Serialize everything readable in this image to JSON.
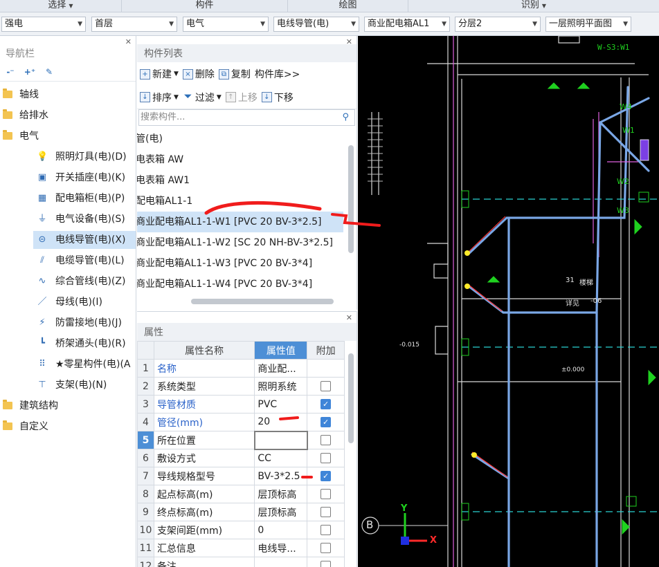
{
  "ribbon": {
    "groups": [
      "选择",
      "构件",
      "绘图",
      "识别"
    ]
  },
  "selectors": [
    {
      "value": "强电"
    },
    {
      "value": "首层"
    },
    {
      "value": "电气"
    },
    {
      "value": "电线导管(电)"
    },
    {
      "value": "商业配电箱AL1"
    },
    {
      "value": "分层2"
    },
    {
      "value": "一层照明平面图"
    }
  ],
  "nav": {
    "title": "导航栏",
    "tree": [
      {
        "label": "轴线",
        "level": 0,
        "icon": "folder-icon"
      },
      {
        "label": "给排水",
        "level": 0,
        "icon": "folder-icon"
      },
      {
        "label": "电气",
        "level": 0,
        "icon": "folder-icon"
      },
      {
        "label": "照明灯具(电)(D)",
        "level": 1,
        "icon": "light-bulb-icon"
      },
      {
        "label": "开关插座(电)(K)",
        "level": 1,
        "icon": "switch-socket-icon"
      },
      {
        "label": "配电箱柜(电)(P)",
        "level": 1,
        "icon": "distribution-box-icon"
      },
      {
        "label": "电气设备(电)(S)",
        "level": 1,
        "icon": "electrical-equipment-icon"
      },
      {
        "label": "电线导管(电)(X)",
        "level": 1,
        "icon": "wire-conduit-icon",
        "selected": true
      },
      {
        "label": "电缆导管(电)(L)",
        "level": 1,
        "icon": "cable-conduit-icon"
      },
      {
        "label": "综合管线(电)(Z)",
        "level": 1,
        "icon": "pipeline-icon"
      },
      {
        "label": "母线(电)(I)",
        "level": 1,
        "icon": "busbar-icon"
      },
      {
        "label": "防雷接地(电)(J)",
        "level": 1,
        "icon": "lightning-icon"
      },
      {
        "label": "桥架通头(电)(R)",
        "level": 1,
        "icon": "tray-fitting-icon"
      },
      {
        "label": "★零星构件(电)(A",
        "level": 1,
        "icon": "grid-icon"
      },
      {
        "label": "支架(电)(N)",
        "level": 1,
        "icon": "bracket-icon"
      },
      {
        "label": "建筑结构",
        "level": 0,
        "icon": "folder-icon"
      },
      {
        "label": "自定义",
        "level": 0,
        "icon": "folder-icon"
      }
    ]
  },
  "component_list": {
    "title": "构件列表",
    "toolbar1": {
      "new": "新建",
      "delete": "删除",
      "copy": "复制",
      "library": "构件库>>"
    },
    "toolbar2": {
      "sort": "排序",
      "filter": "过滤",
      "up": "上移",
      "down": "下移"
    },
    "search_placeholder": "搜索构件...",
    "items": [
      "管(电)",
      "电表箱 AW",
      "电表箱 AW1",
      "配电箱AL1-1",
      "商业配电箱AL1-1-W1 [PVC 20 BV-3*2.5]",
      "商业配电箱AL1-1-W2 [SC 20 NH-BV-3*2.5]",
      "商业配电箱AL1-1-W3 [PVC 20 BV-3*4]",
      "商业配电箱AL1-1-W4 [PVC 20 BV-3*4]"
    ],
    "active_index": 4
  },
  "properties": {
    "title": "属性",
    "headers": {
      "name": "属性名称",
      "value": "属性值",
      "extra": "附加"
    },
    "rows": [
      {
        "no": "1",
        "name": "名称",
        "value": "商业配...",
        "blue": true,
        "check": null
      },
      {
        "no": "2",
        "name": "系统类型",
        "value": "照明系统",
        "blue": false,
        "check": false
      },
      {
        "no": "3",
        "name": "导管材质",
        "value": "PVC",
        "blue": true,
        "check": true
      },
      {
        "no": "4",
        "name": "管径(mm)",
        "value": "20",
        "blue": true,
        "check": true
      },
      {
        "no": "5",
        "name": "所在位置",
        "value": "",
        "blue": false,
        "check": false,
        "current": true
      },
      {
        "no": "6",
        "name": "敷设方式",
        "value": "CC",
        "blue": false,
        "check": false
      },
      {
        "no": "7",
        "name": "导线规格型号",
        "value": "BV-3*2.5",
        "blue": false,
        "check": true
      },
      {
        "no": "8",
        "name": "起点标高(m)",
        "value": "层顶标高",
        "blue": false,
        "check": false
      },
      {
        "no": "9",
        "name": "终点标高(m)",
        "value": "层顶标高",
        "blue": false,
        "check": false
      },
      {
        "no": "10",
        "name": "支架间距(mm)",
        "value": "0",
        "blue": false,
        "check": false
      },
      {
        "no": "11",
        "name": "汇总信息",
        "value": "电线导...",
        "blue": false,
        "check": false
      },
      {
        "no": "12",
        "name": "备注",
        "value": "",
        "blue": false,
        "check": false
      }
    ]
  },
  "canvas": {
    "labels": {
      "top": "W-S3:W1",
      "w4": "W4",
      "w1": "W1",
      "w2": "W2",
      "w3": "W3",
      "room": "楼梯",
      "room_num": "31",
      "room2": "详见",
      "room2_num": "-06",
      "elev_left": "-0.015",
      "elev_mid": "±0.000",
      "axis": "B",
      "y": "Y",
      "x": "X"
    }
  },
  "colors": {
    "accent": "#4d8fd6",
    "selection": "#cfe3f7",
    "canvas_bg": "#000000",
    "conduit": "#7aa7e6",
    "annotation": "#ff2a2a"
  }
}
